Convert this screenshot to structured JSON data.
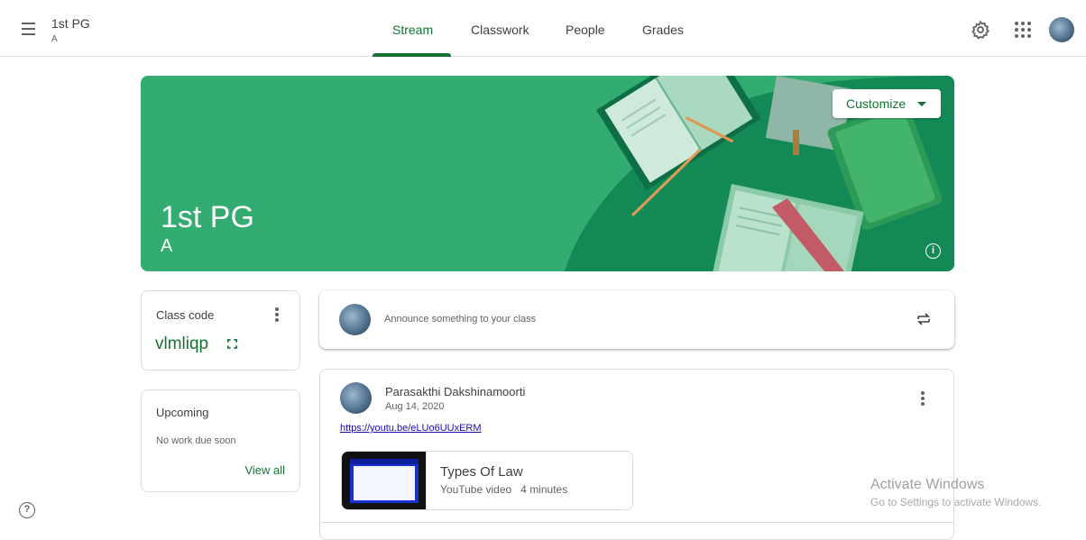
{
  "header": {
    "class_name": "1st PG",
    "section": "A",
    "tabs": [
      {
        "label": "Stream",
        "active": true
      },
      {
        "label": "Classwork",
        "active": false
      },
      {
        "label": "People",
        "active": false
      },
      {
        "label": "Grades",
        "active": false
      }
    ],
    "icons": [
      "menu-icon",
      "gear-icon",
      "apps-grid-icon",
      "account-avatar"
    ]
  },
  "banner": {
    "title": "1st PG",
    "section": "A",
    "customize_label": "Customize",
    "info_icon": "info-icon",
    "colors": {
      "background": "#33ac71",
      "accent": "#137333"
    }
  },
  "class_code": {
    "label": "Class code",
    "value": "vlmliqp"
  },
  "upcoming": {
    "title": "Upcoming",
    "empty_text": "No work due soon",
    "view_all": "View all"
  },
  "announce": {
    "placeholder": "Announce something to your class"
  },
  "post": {
    "author": "Parasakthi Dakshinamoorti",
    "date": "Aug 14, 2020",
    "link": "https://youtu.be/eLUo6UUxERM",
    "attachment": {
      "title": "Types Of Law",
      "subtitle": "YouTube video   4 minutes"
    }
  },
  "watermark": {
    "title": "Activate Windows",
    "subtitle": "Go to Settings to activate Windows."
  }
}
